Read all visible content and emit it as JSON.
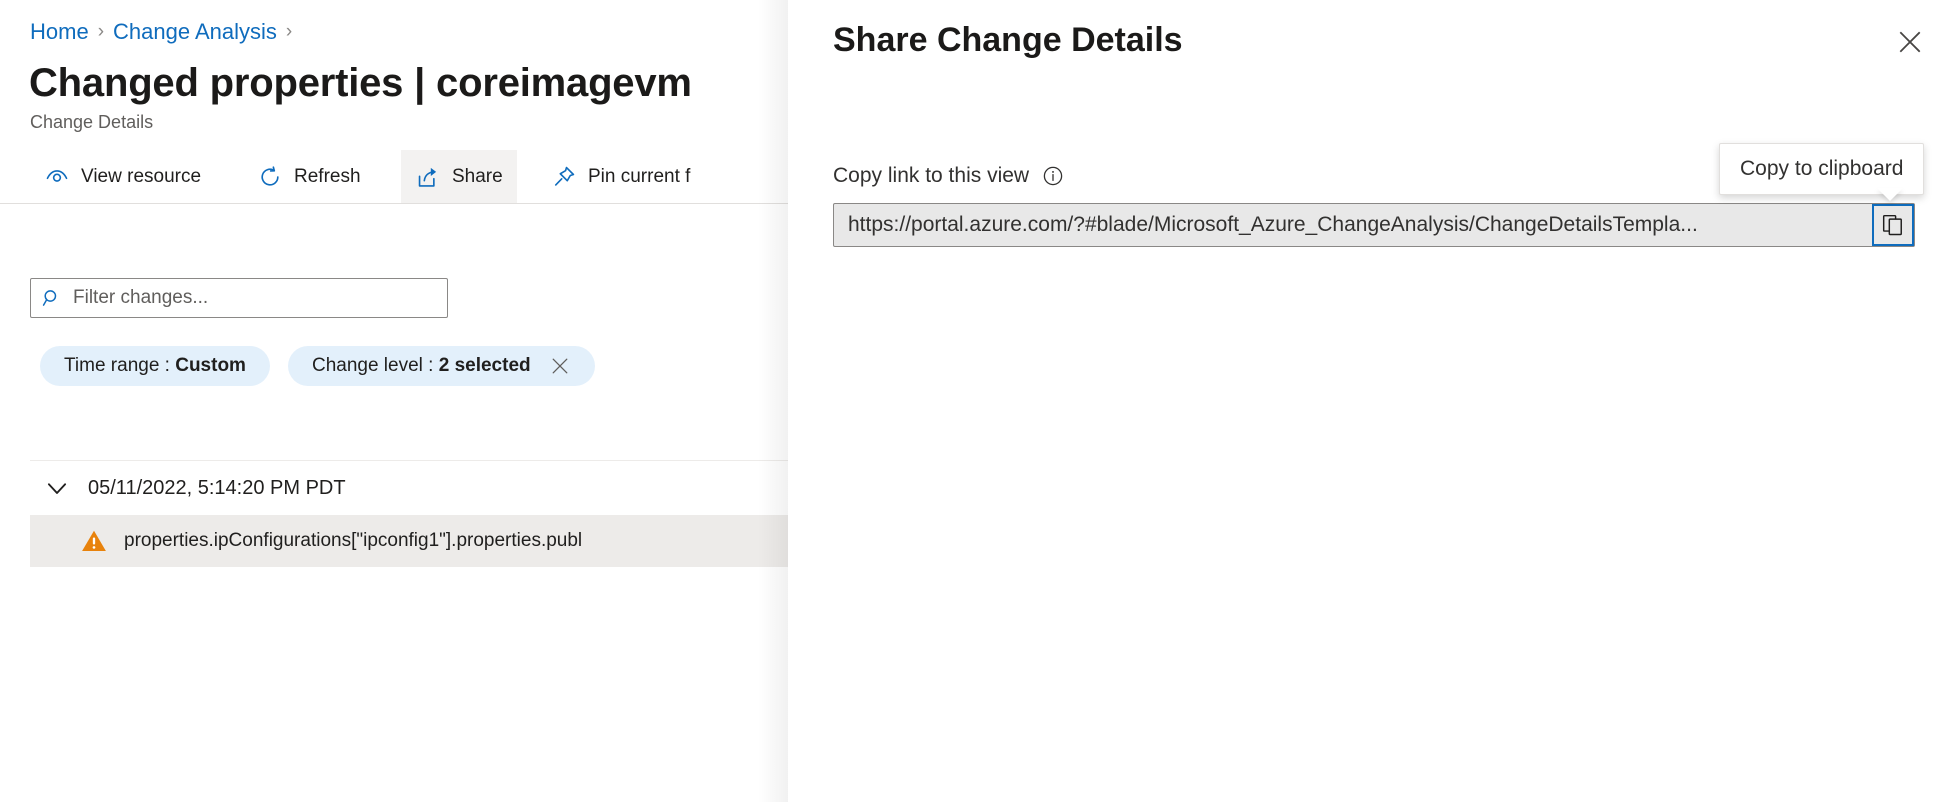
{
  "breadcrumb": {
    "items": [
      {
        "label": "Home",
        "separator": "›"
      },
      {
        "label": "Change Analysis",
        "separator": "›"
      }
    ]
  },
  "header": {
    "title": "Changed properties | coreimagevm",
    "subtitle": "Change Details"
  },
  "commandbar": {
    "items": [
      {
        "label": "View resource",
        "icon": "eye-icon",
        "active": false
      },
      {
        "label": "Refresh",
        "icon": "refresh-icon",
        "active": false
      },
      {
        "label": "Share",
        "icon": "share-icon",
        "active": true
      },
      {
        "label": "Pin current f",
        "icon": "pin-icon",
        "active": false
      }
    ]
  },
  "filter": {
    "placeholder": "Filter changes...",
    "value": "",
    "icon": "search-icon"
  },
  "chips": [
    {
      "prefix": "Time range : ",
      "value": "Custom",
      "removable": false
    },
    {
      "prefix": "Change level : ",
      "value": "2 selected",
      "removable": true,
      "close_icon": "close-icon"
    }
  ],
  "changes": {
    "group": {
      "timestamp": "05/11/2022, 5:14:20 PM PDT",
      "expanded": true,
      "chevron_icon": "chevron-down-icon"
    },
    "rows": [
      {
        "severity_icon": "warning-icon",
        "severity_color": "#e8820c",
        "text": "properties.ipConfigurations[\"ipconfig1\"].properties.publ"
      }
    ]
  },
  "share_panel": {
    "title": "Share Change Details",
    "close_icon": "close-icon",
    "copy_link_label": "Copy link to this view",
    "info_icon": "info-icon",
    "url_value": "https://portal.azure.com/?#blade/Microsoft_Azure_ChangeAnalysis/ChangeDetailsTempla...",
    "copy_button_icon": "copy-icon",
    "tooltip": "Copy to clipboard"
  },
  "colors": {
    "accent": "#0f6cbd",
    "link": "#0f6cbd",
    "chip_bg": "#e3f0fb",
    "warning": "#e8820c",
    "row_bg": "#edebe9",
    "text_primary": "#201f1e",
    "text_secondary": "#605e5c"
  }
}
